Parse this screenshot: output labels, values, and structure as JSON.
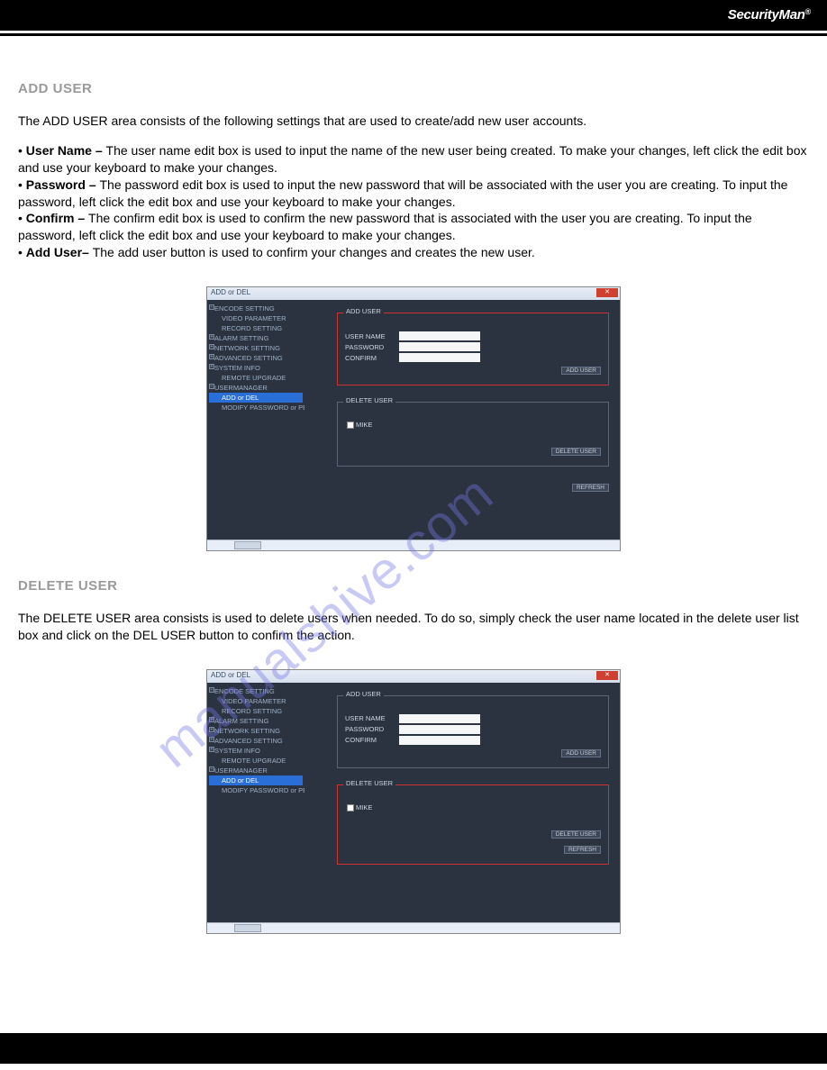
{
  "header": {
    "brand": "SecurityMan",
    "reg": "®"
  },
  "sections": {
    "addUser": {
      "title": "ADD USER",
      "intro": "The ADD USER area consists of the following settings that are used to create/add new user accounts.",
      "bullets": [
        {
          "label": "User Name – ",
          "text": "The user name edit box is used to input the name of the new user being created. To make your changes, left click the edit box and use your keyboard to make your changes."
        },
        {
          "label": "Password – ",
          "text": "The password edit box is used to input the new password that will be associated with the user you are creating. To input the password, left click the edit box and use your keyboard to make your changes."
        },
        {
          "label": "Confirm – ",
          "text": "The confirm edit box is used to confirm the new password that is associated with the user you are creating. To input the password, left click the edit box and use your keyboard to make your changes."
        },
        {
          "label": "Add User– ",
          "text": "The add user button is used to confirm your changes and creates the new user."
        }
      ]
    },
    "deleteUser": {
      "title": "DELETE USER",
      "intro": "The DELETE USER area consists is used to delete users when needed.  To do so, simply check the user name located in the delete user list box and click on the DEL USER button to confirm the action."
    }
  },
  "app": {
    "title": "ADD or DEL",
    "tree": [
      {
        "label": "ENCODE SETTING",
        "pm": "−",
        "child": false
      },
      {
        "label": "VIDEO PARAMETER",
        "pm": "",
        "child": true
      },
      {
        "label": "RECORD SETTING",
        "pm": "",
        "child": true
      },
      {
        "label": "ALARM SETTING",
        "pm": "+",
        "child": false
      },
      {
        "label": "NETWORK SETTING",
        "pm": "+",
        "child": false
      },
      {
        "label": "ADVANCED SETTING",
        "pm": "+",
        "child": false
      },
      {
        "label": "SYSTEM INFO",
        "pm": "+",
        "child": false
      },
      {
        "label": "REMOTE UPGRADE",
        "pm": "",
        "child": true
      },
      {
        "label": "USERMANAGER",
        "pm": "−",
        "child": false
      },
      {
        "label": "ADD or DEL",
        "pm": "",
        "child": true,
        "selected": true
      },
      {
        "label": "MODIFY PASSWORD or PE",
        "pm": "",
        "child": true
      }
    ],
    "groups": {
      "add": {
        "legend": "ADD USER",
        "fields": {
          "username": "USER NAME",
          "password": "PASSWORD",
          "confirm": "CONFIRM"
        },
        "button": "ADD USER"
      },
      "del": {
        "legend": "DELETE USER",
        "userLabel": "MIKE",
        "button": "DELETE USER"
      },
      "refresh": "REFRESH"
    }
  },
  "watermark": "manualshive.com"
}
